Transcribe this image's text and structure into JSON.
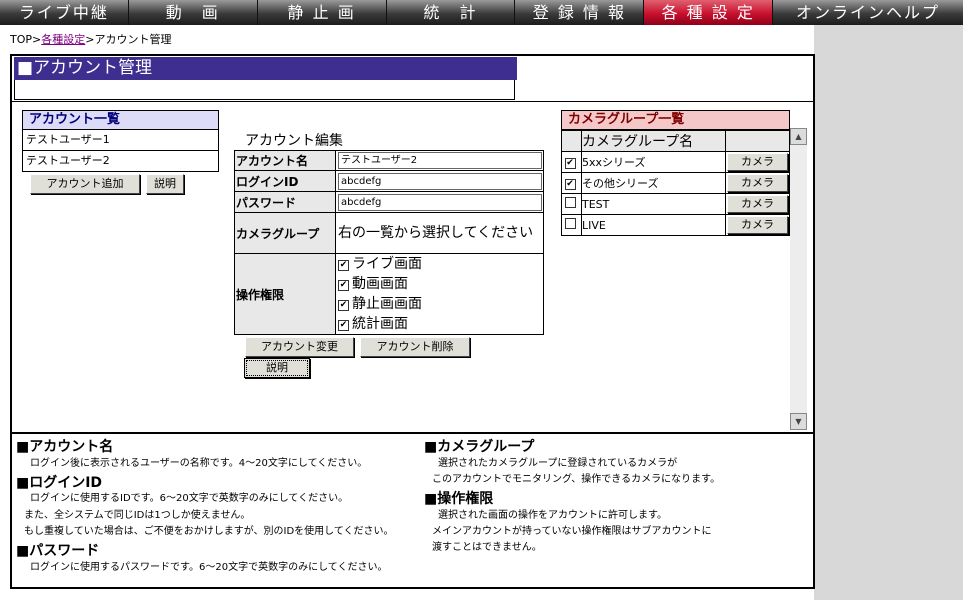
{
  "nav": [
    "ライブ中継",
    "動　画",
    "静 止 画",
    "統　計",
    "登 録 情 報",
    "各 種 設 定",
    "オンラインヘルプ"
  ],
  "nav_active_index": 5,
  "colors": {
    "nav_active": "#c8102e",
    "title_bar": "#3d2e8f",
    "account_head": "#dcdcf8",
    "group_head": "#f4c8c8"
  },
  "breadcrumb": {
    "top": "TOP",
    "sep": ">",
    "link": "各種設定",
    "current": "アカウント管理"
  },
  "page_title": "■アカウント管理",
  "account_list": {
    "title": "アカウント一覧",
    "items": [
      "テストユーザー1",
      "テストユーザー2"
    ],
    "add_button": "アカウント追加",
    "help_button": "説明"
  },
  "edit": {
    "title": "アカウント編集",
    "account_name_label": "アカウント名",
    "account_name_value": "テストユーザー2",
    "login_id_label": "ログインID",
    "login_id_value": "abcdefg",
    "password_label": "パスワード",
    "password_value": "abcdefg",
    "camera_group_label": "カメラグループ",
    "camera_group_value": "右の一覧から選択してください",
    "permission_label": "操作権限",
    "permissions": [
      {
        "label": "ライブ画面",
        "checked": true
      },
      {
        "label": "動画画面",
        "checked": true
      },
      {
        "label": "静止画画面",
        "checked": true
      },
      {
        "label": "統計画面",
        "checked": true
      }
    ],
    "change_button": "アカウント変更",
    "delete_button": "アカウント削除",
    "help_button": "説明"
  },
  "camera_groups": {
    "title": "カメラグループ一覧",
    "column": "カメラグループ名",
    "camera_button": "カメラ",
    "rows": [
      {
        "name": "5xxシリーズ",
        "checked": true
      },
      {
        "name": "その他シリーズ",
        "checked": true
      },
      {
        "name": "TEST",
        "checked": false
      },
      {
        "name": "LIVE",
        "checked": false
      }
    ]
  },
  "help": {
    "account_name_title": "■アカウント名",
    "account_name_text": "ログイン後に表示されるユーザーの名称です。4〜20文字にしてください。",
    "login_id_title": "■ログインID",
    "login_id_text1": "ログインに使用するIDです。6〜20文字で英数字のみにしてください。",
    "login_id_text2": "また、全システムで同じIDは1つしか使えません。",
    "login_id_text3": "もし重複していた場合は、ご不便をおかけしますが、別のIDを使用してください。",
    "password_title": "■パスワード",
    "password_text": "ログインに使用するパスワードです。6〜20文字で英数字のみにしてください。",
    "camera_group_title": "■カメラグループ",
    "camera_group_text1": "選択されたカメラグループに登録されているカメラが",
    "camera_group_text2": "このアカウントでモニタリング、操作できるカメラになります。",
    "permission_title": "■操作権限",
    "permission_text1": "選択された画面の操作をアカウントに許可します。",
    "permission_text2": "メインアカウントが持っていない操作権限はサブアカウントに",
    "permission_text3": "渡すことはできません。"
  }
}
